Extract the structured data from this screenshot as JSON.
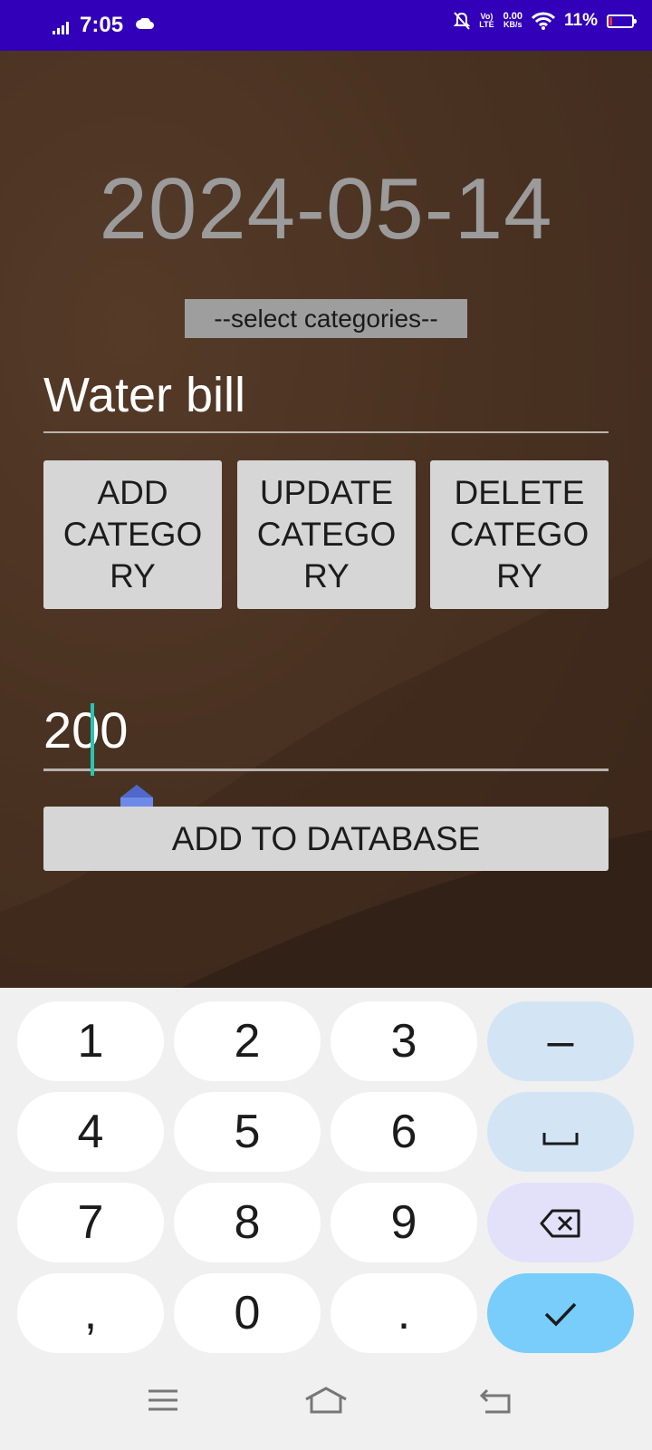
{
  "status_bar": {
    "time": "7:05",
    "net_speed_value": "0.00",
    "net_speed_unit": "KB/s",
    "lte_label_top": "Vo)",
    "lte_label_bottom": "LTE",
    "battery": "11%"
  },
  "app": {
    "date": "2024-05-14",
    "category_spinner": "--select categories--",
    "category_input": "Water bill",
    "buttons": {
      "add": "ADD\nCATEGO\nRY",
      "update": "UPDATE\nCATEGO\nRY",
      "delete": "DELETE\nCATEGO\nRY",
      "add_db": "ADD TO DATABASE"
    },
    "amount_input": "200"
  },
  "keyboard": {
    "keys": [
      "1",
      "2",
      "3",
      "–",
      "4",
      "5",
      "6",
      "␣",
      "7",
      "8",
      "9",
      "⌫",
      ",",
      "0",
      ".",
      "✓"
    ]
  },
  "colors": {
    "status_bar": "#3100b8",
    "app_bg": "#4a3222",
    "button_bg": "#d6d6d6",
    "cursor": "#26c6b0",
    "handle": "#6e8ae8",
    "keyboard_bg": "#f0f0f0",
    "enter_key": "#78cdfb"
  }
}
